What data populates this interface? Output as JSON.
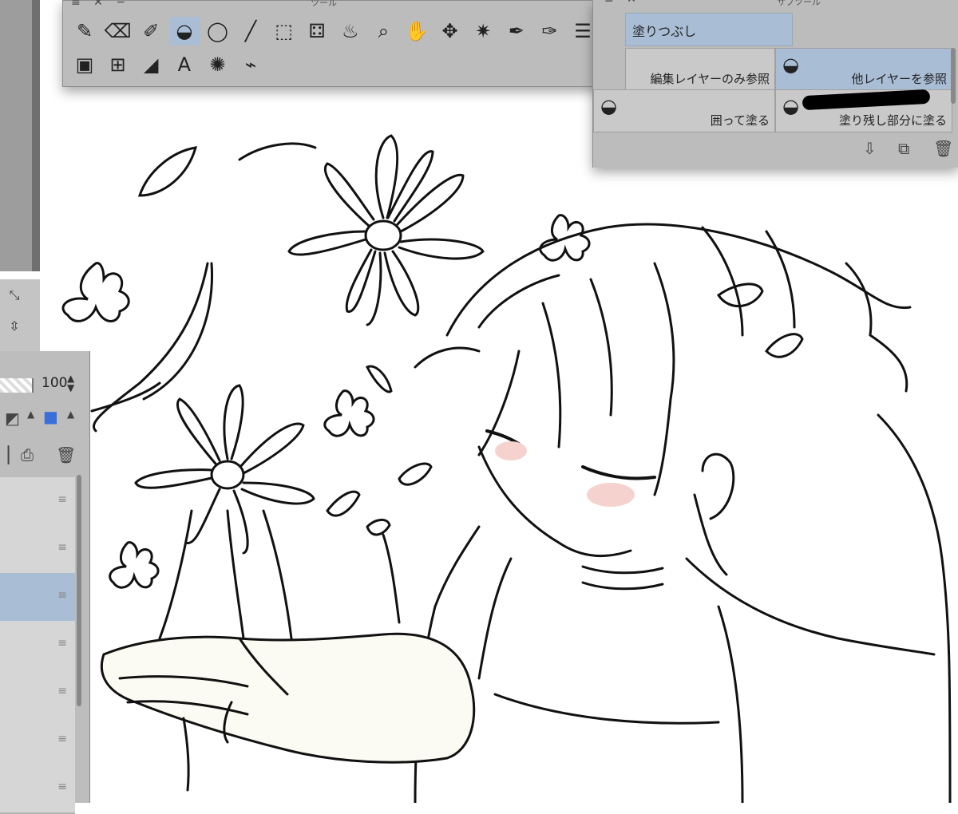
{
  "palette": {
    "title": "ツール",
    "window_buttons": "≡ ✕ −",
    "row1": [
      {
        "name": "pen-tool-icon",
        "glyph": "✎"
      },
      {
        "name": "eraser-tool-icon",
        "glyph": "⌫"
      },
      {
        "name": "eyedropper-tool-icon",
        "glyph": "✐"
      },
      {
        "name": "fill-tool-icon",
        "glyph": "◒",
        "active": true
      },
      {
        "name": "lasso-select-tool-icon",
        "glyph": "◯"
      },
      {
        "name": "line-tool-icon",
        "glyph": "╱"
      },
      {
        "name": "object-select-tool-icon",
        "glyph": "⬚"
      },
      {
        "name": "auto-select-tool-icon",
        "glyph": "⚃"
      },
      {
        "name": "blend-tool-icon",
        "glyph": "♨"
      },
      {
        "name": "zoom-tool-icon",
        "glyph": "⌕"
      },
      {
        "name": "hand-tool-icon",
        "glyph": "✋"
      },
      {
        "name": "move-tool-icon",
        "glyph": "✥"
      },
      {
        "name": "sparkle-tool-icon",
        "glyph": "✷"
      },
      {
        "name": "vector-pen-tool-icon",
        "glyph": "✒"
      },
      {
        "name": "correct-line-tool-icon",
        "glyph": "✑"
      },
      {
        "name": "menu-icon",
        "glyph": "☰"
      }
    ],
    "row2": [
      {
        "name": "gradient-tool-icon",
        "glyph": "▣"
      },
      {
        "name": "frame-border-tool-icon",
        "glyph": "⊞"
      },
      {
        "name": "ruler-tool-icon",
        "glyph": "◢"
      },
      {
        "name": "text-tool-icon",
        "glyph": "A"
      },
      {
        "name": "balloon-tool-icon",
        "glyph": "✺"
      },
      {
        "name": "decoration-tool-icon",
        "glyph": "⌁"
      }
    ]
  },
  "subtool": {
    "title": "サブツール",
    "window_buttons": "≡ ✕ −",
    "group_label": "塗りつぶし",
    "items": [
      {
        "label": "編集レイヤーのみ参照",
        "selected": false
      },
      {
        "label": "他レイヤーを参照",
        "selected": true
      },
      {
        "label": "囲って塗る",
        "selected": false
      },
      {
        "label": "塗り残し部分に塗る",
        "selected": false
      }
    ],
    "bottom_icons": [
      "download-icon",
      "duplicate-icon",
      "trash-icon"
    ]
  },
  "layer_panel": {
    "opacity_value": "100",
    "layers": [
      {
        "selected": false
      },
      {
        "selected": false
      },
      {
        "selected": true
      },
      {
        "selected": false
      },
      {
        "selected": false
      },
      {
        "selected": false
      },
      {
        "selected": false
      }
    ]
  },
  "colors": {
    "panel_bg": "#bcbcbc",
    "selected_bg": "#a9bdd5",
    "dark_strip": "#6f6f6f"
  }
}
